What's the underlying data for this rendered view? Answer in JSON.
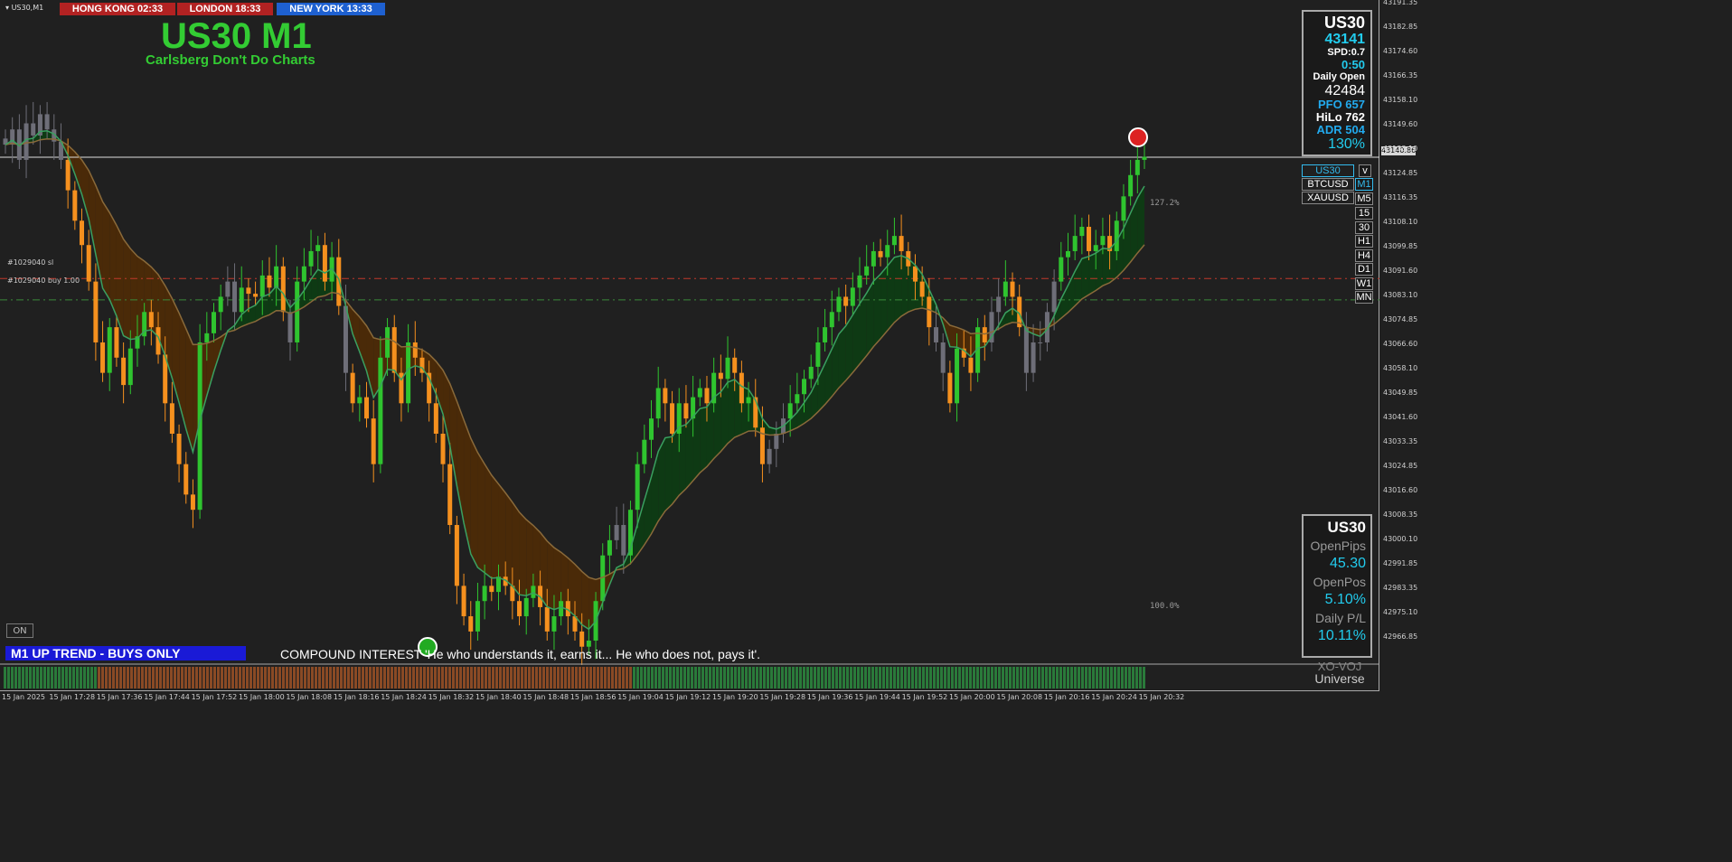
{
  "window": {
    "symbol_label": "US30,M1"
  },
  "sessions": [
    {
      "label": "HONG KONG 02:33",
      "bg": "#b22222"
    },
    {
      "label": "LONDON   18:33",
      "bg": "#b22222"
    },
    {
      "label": "NEW YORK 13:33",
      "bg": "#1e60d0"
    }
  ],
  "title": {
    "main": "US30 M1",
    "sub": "Carlsberg Don't Do Charts",
    "color": "#33cc33"
  },
  "info_panel": {
    "symbol": "US30",
    "price": "43141",
    "spread": "SPD:0.7",
    "timer": "0:50",
    "daily_open_label": "Daily Open",
    "daily_open_value": "42484",
    "pfo": "PFO 657",
    "hilo": "HiLo 762",
    "adr": "ADR 504",
    "pct": "130%"
  },
  "symbol_buttons": [
    "US30",
    "BTCUSD",
    "XAUUSD"
  ],
  "symbol_toggle": "v",
  "timeframes": [
    "M1",
    "M5",
    "15",
    "30",
    "H1",
    "H4",
    "D1",
    "W1",
    "MN"
  ],
  "levels": {
    "sl_label": "#1029040 sl",
    "buy_label": "#1029040 buy 1.00",
    "fib_top": "127.2%",
    "fib_bottom": "100.0%",
    "current_price": "43140.86"
  },
  "trend_banner": "M1  UP TREND - BUYS ONLY",
  "quote": "COMPOUND INTEREST  'He who understands it, earns it... He who does not, pays it'.",
  "on_button": "ON",
  "position_panel": {
    "symbol": "US30",
    "open_pips_label": "OpenPips",
    "open_pips_value": "45.30",
    "open_pos_label": "OpenPos",
    "open_pos_value": "5.10%",
    "daily_pl_label": "Daily P/L",
    "daily_pl_value": "10.11%"
  },
  "brand": {
    "line1": "XO-VOJ",
    "line2": "Universe"
  },
  "colors": {
    "bull": "#2fc42f",
    "bear": "#f5901e",
    "neutral": "#6e6e78",
    "ribbon_bear": "#4a2a08",
    "ribbon_bull": "#0e3a14"
  },
  "chart_data": {
    "type": "candlestick",
    "y_ticks": [
      "43191.35",
      "43182.85",
      "43174.60",
      "43166.35",
      "43158.10",
      "43149.60",
      "43133.10",
      "43124.85",
      "43116.35",
      "43108.10",
      "43099.85",
      "43091.60",
      "43083.10",
      "43074.85",
      "43066.60",
      "43058.10",
      "43049.85",
      "43041.60",
      "43033.35",
      "43024.85",
      "43016.60",
      "43008.35",
      "43000.10",
      "42991.85",
      "42983.35",
      "42975.10",
      "42966.85"
    ],
    "x_ticks": [
      "15 Jan 2025",
      "15 Jan 17:28",
      "15 Jan 17:36",
      "15 Jan 17:44",
      "15 Jan 17:52",
      "15 Jan 18:00",
      "15 Jan 18:08",
      "15 Jan 18:16",
      "15 Jan 18:24",
      "15 Jan 18:32",
      "15 Jan 18:40",
      "15 Jan 18:48",
      "15 Jan 18:56",
      "15 Jan 19:04",
      "15 Jan 19:12",
      "15 Jan 19:20",
      "15 Jan 19:28",
      "15 Jan 19:36",
      "15 Jan 19:44",
      "15 Jan 19:52",
      "15 Jan 20:00",
      "15 Jan 20:08",
      "15 Jan 20:16",
      "15 Jan 20:24",
      "15 Jan 20:32"
    ],
    "price_range": [
      42966.85,
      43191.35
    ],
    "closes": [
      43145,
      43150,
      43140,
      43152,
      43148,
      43155,
      43150,
      43146,
      43140,
      43130,
      43120,
      43112,
      43100,
      43080,
      43070,
      43085,
      43075,
      43066,
      43078,
      43082,
      43090,
      43085,
      43076,
      43060,
      43050,
      43040,
      43030,
      43025,
      43080,
      43083,
      43090,
      43095,
      43100,
      43090,
      43098,
      43096,
      43095,
      43102,
      43098,
      43105,
      43090,
      43080,
      43100,
      43105,
      43110,
      43112,
      43100,
      43108,
      43092,
      43070,
      43060,
      43062,
      43055,
      43040,
      43075,
      43085,
      43070,
      43060,
      43080,
      43075,
      43070,
      43060,
      43050,
      43040,
      43020,
      43000,
      42990,
      42985,
      42995,
      43000,
      42998,
      43003,
      43000,
      42995,
      42990,
      42996,
      43000,
      42993,
      42985,
      42990,
      42995,
      42990,
      42985,
      42980,
      42982,
      42995,
      43010,
      43015,
      43020,
      43010,
      43025,
      43040,
      43048,
      43055,
      43065,
      43060,
      43050,
      43060,
      43055,
      43062,
      43065,
      43060,
      43070,
      43068,
      43075,
      43070,
      43060,
      43062,
      43052,
      43040,
      43045,
      43050,
      43055,
      43060,
      43063,
      43068,
      43072,
      43080,
      43085,
      43090,
      43095,
      43092,
      43098,
      43102,
      43105,
      43110,
      43108,
      43112,
      43115,
      43110,
      43105,
      43100,
      43095,
      43085,
      43080,
      43070,
      43060,
      43078,
      43075,
      43070,
      43085,
      43080,
      43090,
      43095,
      43100,
      43095,
      43085,
      43070,
      43080,
      43080,
      43090,
      43100,
      43108,
      43110,
      43115,
      43118,
      43110,
      43112,
      43115,
      43110,
      43120,
      43128,
      43135,
      43140,
      43141
    ]
  }
}
